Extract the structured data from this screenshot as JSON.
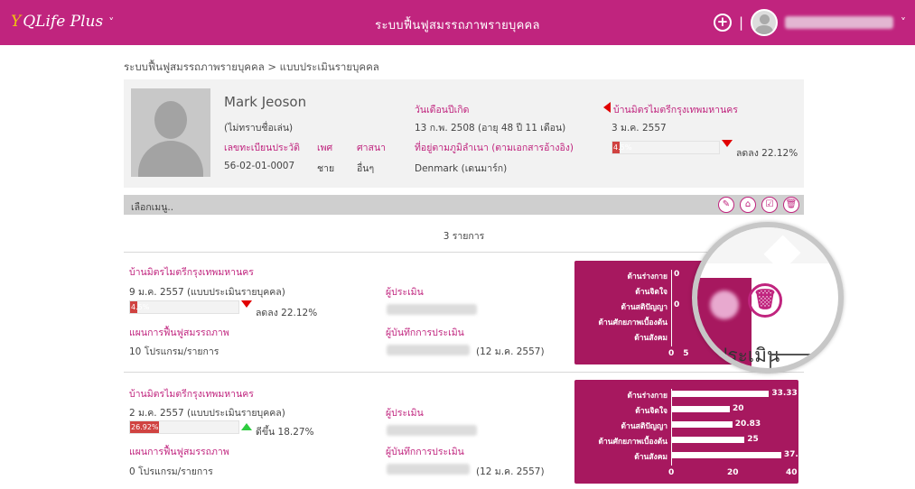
{
  "topbar": {
    "logo": "QLife Plus",
    "app_title": "ระบบฟื้นฟูสมรรถภาพรายบุคคล",
    "plus_icon": "+",
    "separator": "|"
  },
  "breadcrumb": "ระบบฟื้นฟูสมรรถภาพรายบุคคล > แบบประเมินรายบุคคล",
  "profile": {
    "name": "Mark Jeoson",
    "nickname": "(ไม่ทราบชื่อเล่น)",
    "id_label": "เลขทะเบียนประวัติ",
    "id_value": "56-02-01-0007",
    "sex_label": "เพศ",
    "sex_value": "ชาย",
    "religion_label": "ศาสนา",
    "religion_value": "อื่นๆ",
    "dob_label": "วันเดือนปีเกิด",
    "dob_value": "13 ก.พ. 2508 (อายุ 48 ปี 11 เดือน)",
    "domicile_label": "ที่อยู่ตามภูมิลำเนา (ตามเอกสารอ้างอิง)",
    "domicile_value": "Denmark (เดนมาร์ก)",
    "place": "บ้านมิตรไมตรีกรุงเทพมหานคร",
    "latest_date": "3 ม.ค. 2557",
    "progress_label": "4.5%",
    "progress": 4.5,
    "trend": "ลดลง 22.12%"
  },
  "menubar": {
    "label": "เลือกเมนู..",
    "icons": [
      "edit-icon",
      "home-icon",
      "checklist-icon",
      "trash-icon"
    ],
    "glyphs": [
      "✎",
      "⌂",
      "☑",
      "🗑"
    ]
  },
  "count_text": "3 รายการ",
  "assessments": [
    {
      "place": "บ้านมิตรไมตรีกรุงเทพมหานคร",
      "date": "9 ม.ค. 2557 (แบบประเมินรายบุคคล)",
      "progress_label": "4.5%",
      "progress": 4.5,
      "trend": "ลดลง 22.12%",
      "trend_dir": "down",
      "plan_label": "แผนการฟื้นฟูสมรรถภาพ",
      "plan_value": "10 โปรแกรม/รายการ",
      "assessor_label": "ผู้ประเมิน",
      "recorder_label": "ผู้บันทึกการประเมิน",
      "recorded_date": "(12 ม.ค. 2557)"
    },
    {
      "place": "บ้านมิตรไมตรีกรุงเทพมหานคร",
      "date": "2 ม.ค. 2557 (แบบประเมินรายบุคคล)",
      "progress_label": "26.92%",
      "progress": 26.92,
      "trend": "ดีขึ้น 18.27%",
      "trend_dir": "up",
      "plan_label": "แผนการฟื้นฟูสมรรถภาพ",
      "plan_value": "0 โปรแกรม/รายการ",
      "assessor_label": "ผู้ประเมิน",
      "recorder_label": "ผู้บันทึกการประเมิน",
      "recorded_date": "(12 ม.ค. 2557)"
    }
  ],
  "chart_data": [
    {
      "type": "bar",
      "orientation": "horizontal",
      "categories": [
        "ด้านร่างกาย",
        "ด้านจิตใจ",
        "ด้านสติปัญญา",
        "ด้านศักยภาพเบื้องต้น",
        "ด้านสังคม"
      ],
      "values": [
        0,
        null,
        0,
        null,
        null
      ],
      "value_labels": [
        "0",
        "",
        "0",
        "",
        ""
      ],
      "xticks": [
        "0",
        "5"
      ],
      "xlim": [
        0,
        40
      ],
      "note": "partially hidden by magnifier overlay"
    },
    {
      "type": "bar",
      "orientation": "horizontal",
      "categories": [
        "ด้านร่างกาย",
        "ด้านจิตใจ",
        "ด้านสติปัญญา",
        "ด้านศักยภาพเบื้องต้น",
        "ด้านสังคม"
      ],
      "values": [
        33.33,
        20,
        20.83,
        25,
        37.5
      ],
      "value_labels": [
        "33.33",
        "20",
        "20.83",
        "25",
        "37."
      ],
      "xticks": [
        "0",
        "20",
        "40"
      ],
      "xlim": [
        0,
        40
      ]
    }
  ],
  "magnifier": {
    "text": "ประเมิน",
    "button_text": "ลบ",
    "trash_glyph": "🗑"
  },
  "colors": {
    "brand": "#c0247e",
    "chart_bg": "#a7185f",
    "down": "#e10000",
    "up": "#2ecc40",
    "progress_fill": "#d04341"
  }
}
